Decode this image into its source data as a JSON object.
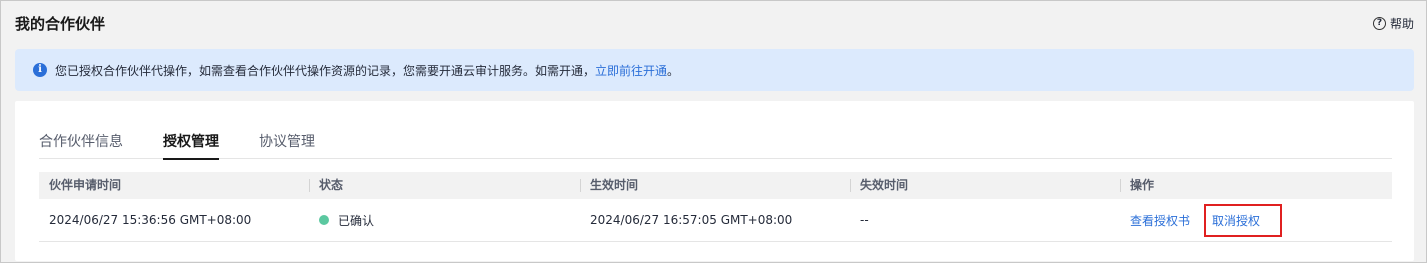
{
  "header": {
    "title": "我的合作伙伴",
    "help_label": "帮助",
    "help_icon": "question-circle-icon"
  },
  "notice": {
    "icon": "info-icon",
    "text": "您已授权合作伙伴代操作，如需查看合作伙伴代操作资源的记录，您需要开通云审计服务。如需开通，",
    "link_text": "立即前往开通",
    "suffix": "。"
  },
  "tabs": [
    {
      "label": "合作伙伴信息",
      "active": false
    },
    {
      "label": "授权管理",
      "active": true
    },
    {
      "label": "协议管理",
      "active": false
    }
  ],
  "table": {
    "columns": [
      "伙伴申请时间",
      "状态",
      "生效时间",
      "失效时间",
      "操作"
    ],
    "rows": [
      {
        "apply_time": "2024/06/27 15:36:56 GMT+08:00",
        "status": "已确认",
        "status_color": "#5bc8a0",
        "effective_time": "2024/06/27 16:57:05 GMT+08:00",
        "expire_time": "--",
        "actions": [
          "查看授权书",
          "取消授权"
        ]
      }
    ]
  },
  "colors": {
    "link": "#2b6fd8",
    "notice_bg": "#dceafd",
    "highlight": "#e02020"
  }
}
